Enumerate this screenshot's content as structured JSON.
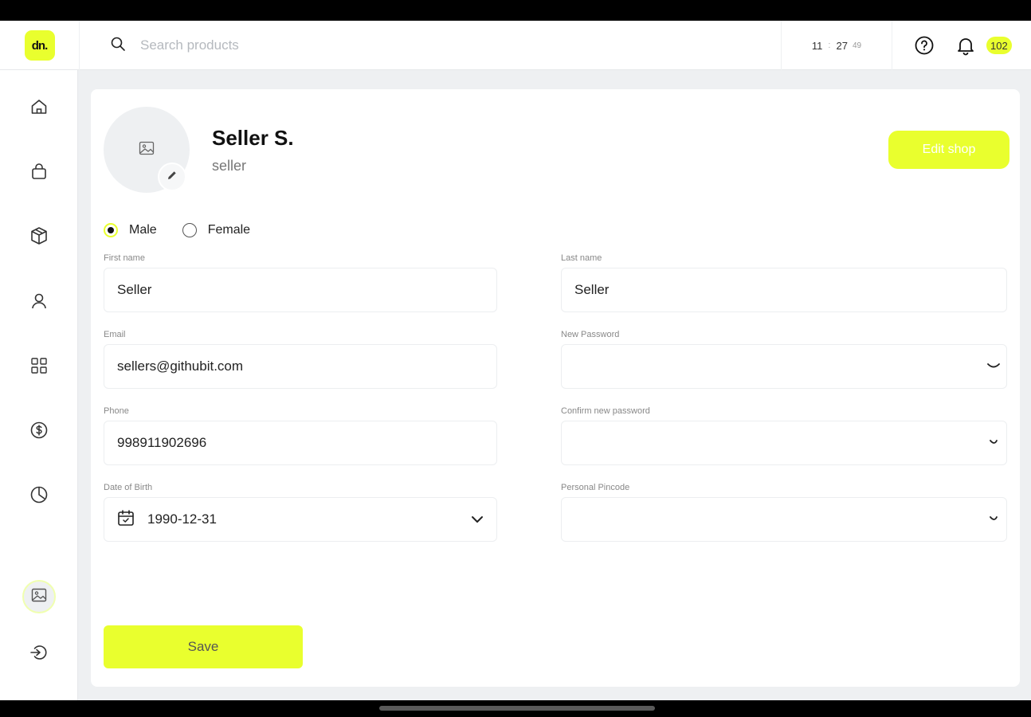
{
  "app": {
    "logo_text": "dn.",
    "accent_color": "#e9ff2e"
  },
  "header": {
    "search_placeholder": "Search products",
    "clock": {
      "hours": "11",
      "minutes": "27",
      "seconds": "49"
    },
    "notification_count": "102",
    "icons": [
      "search-icon",
      "help-icon",
      "bell-icon"
    ]
  },
  "sidebar": {
    "items": [
      {
        "icon": "home-icon"
      },
      {
        "icon": "shopping-bag-icon"
      },
      {
        "icon": "gift-box-icon"
      },
      {
        "icon": "user-icon"
      },
      {
        "icon": "grid-icon"
      },
      {
        "icon": "dollar-icon"
      },
      {
        "icon": "pie-chart-icon"
      }
    ],
    "bottom": [
      {
        "icon": "avatar-image-icon"
      },
      {
        "icon": "logout-icon"
      }
    ]
  },
  "profile": {
    "name": "Seller S.",
    "role": "seller",
    "edit_shop_label": "Edit shop"
  },
  "form": {
    "gender": {
      "options": [
        "Male",
        "Female"
      ],
      "selected": "Male"
    },
    "first_name": {
      "label": "First name",
      "value": "Seller"
    },
    "last_name": {
      "label": "Last name",
      "value": "Seller"
    },
    "email": {
      "label": "Email",
      "value": "sellers@githubit.com"
    },
    "new_password": {
      "label": "New Password",
      "value": ""
    },
    "phone": {
      "label": "Phone",
      "value": "998911902696"
    },
    "confirm_password": {
      "label": "Confirm new password",
      "value": ""
    },
    "dob": {
      "label": "Date of Birth",
      "value": "1990-12-31"
    },
    "pincode": {
      "label": "Personal Pincode",
      "value": ""
    },
    "save_label": "Save"
  }
}
